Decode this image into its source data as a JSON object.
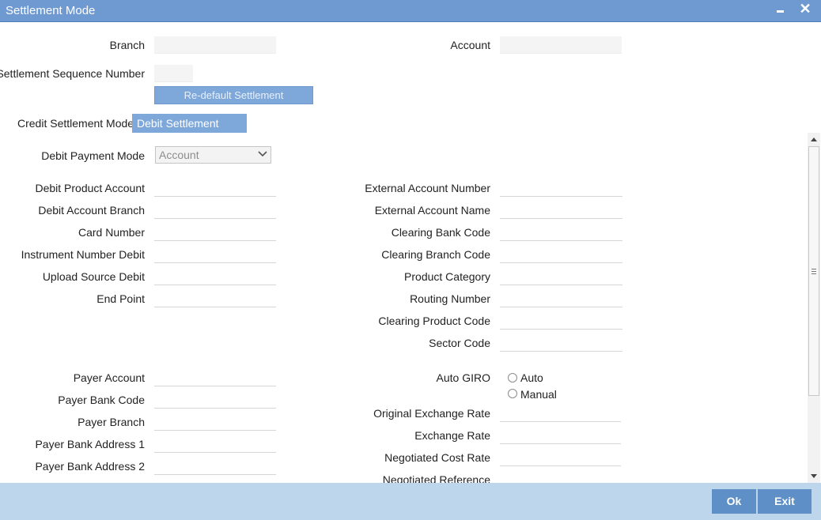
{
  "window": {
    "title": "Settlement Mode",
    "minimize_label": "",
    "close_label": "✕"
  },
  "header": {
    "branch_label": "Branch",
    "account_label": "Account",
    "sequence_label": "Settlement Sequence Number",
    "redefault_button": "Re-default Settlement"
  },
  "tabs": [
    {
      "label": "Credit Settlement Mode",
      "active": false
    },
    {
      "label": "Debit Settlement Mode",
      "active": true
    }
  ],
  "debit": {
    "payment_mode_label": "Debit Payment Mode",
    "payment_mode_value": "Account",
    "left_fields": [
      "Debit Product Account",
      "Debit Account Branch",
      "Card Number",
      "Instrument Number Debit",
      "Upload Source Debit",
      "End Point"
    ],
    "right_fields": [
      "External Account Number",
      "External Account Name",
      "Clearing Bank Code",
      "Clearing Branch Code",
      "Product Category",
      "Routing Number",
      "Clearing Product Code",
      "Sector Code"
    ],
    "payer_fields": [
      "Payer Account",
      "Payer Bank Code",
      "Payer Branch",
      "Payer Bank Address 1",
      "Payer Bank Address 2"
    ],
    "auto_giro": {
      "label": "Auto GIRO",
      "options": [
        "Auto",
        "Manual"
      ]
    },
    "rate_fields": [
      "Original Exchange Rate",
      "Exchange Rate",
      "Negotiated Cost Rate",
      "Negotiated Reference"
    ]
  },
  "footer": {
    "ok_label": "Ok",
    "exit_label": "Exit"
  },
  "colors": {
    "titlebar": "#6f9ad1",
    "accent": "#7ea7da",
    "footer": "#bed6ec",
    "footer_button": "#5f8fc7"
  }
}
